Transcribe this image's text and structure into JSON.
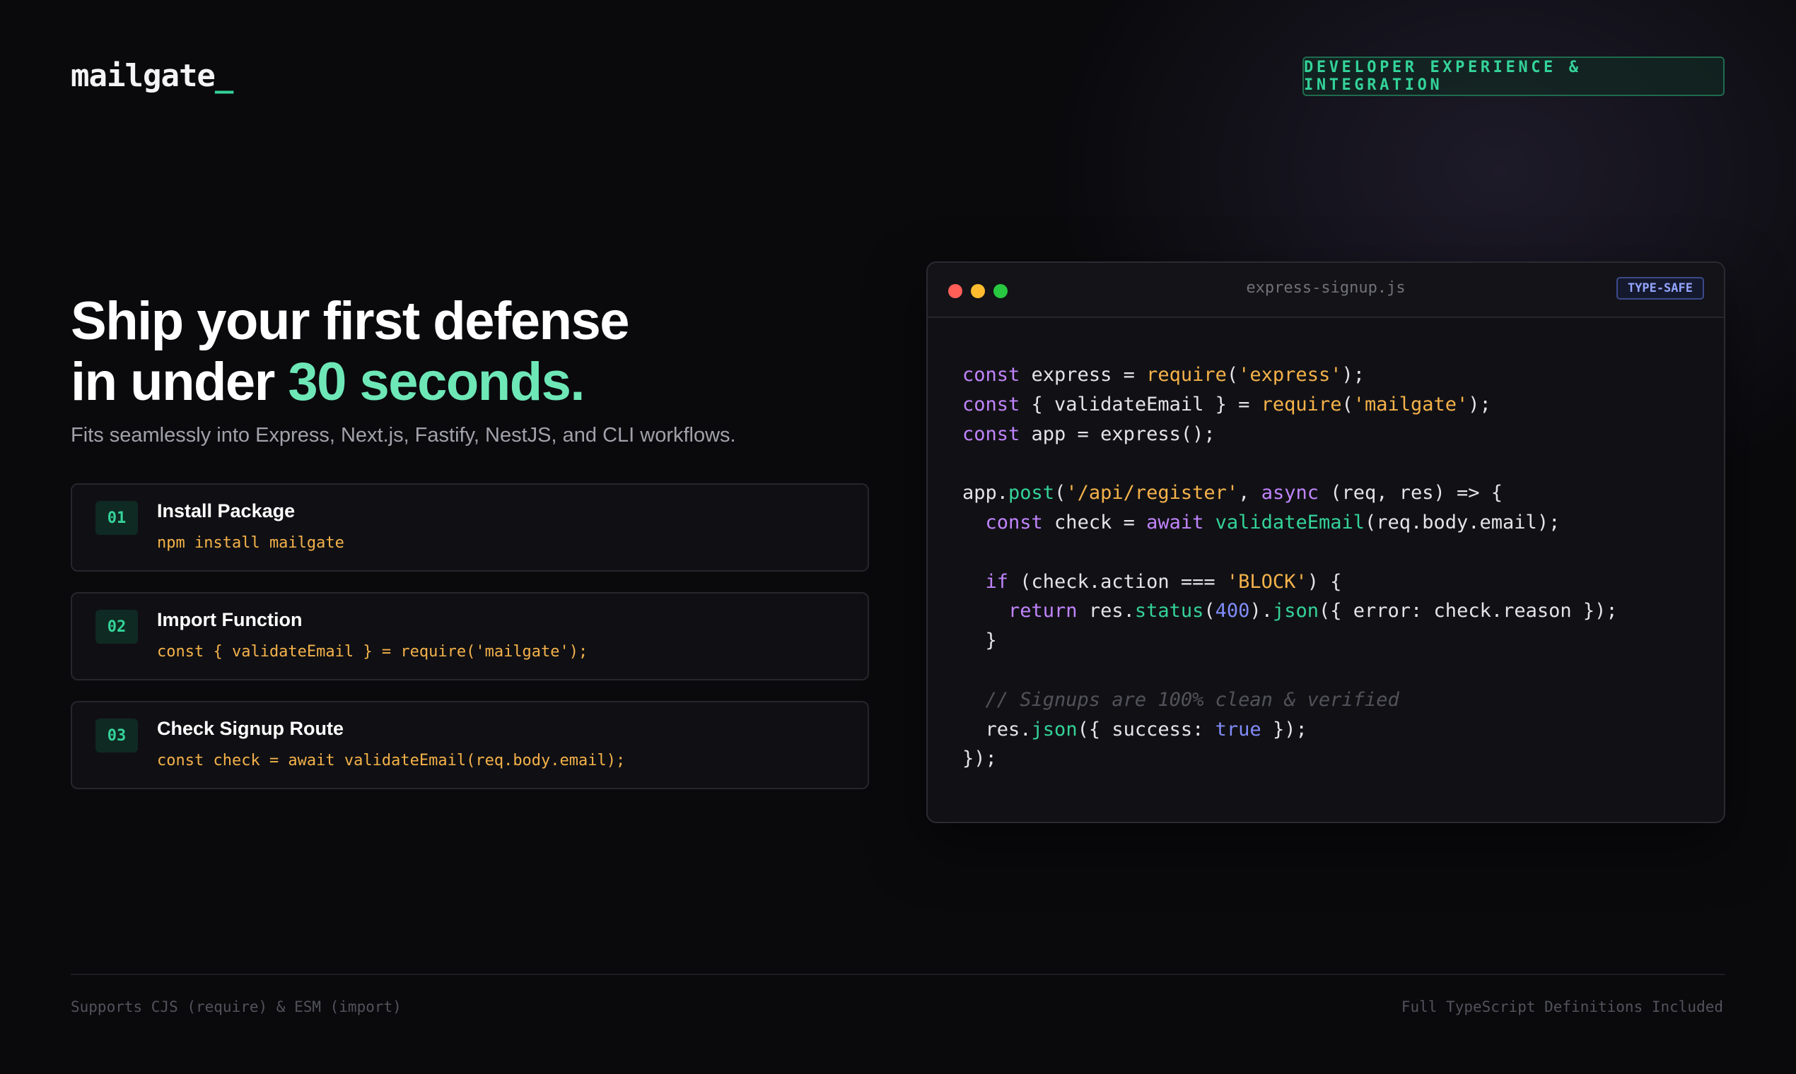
{
  "brand": {
    "name": "mailgate",
    "cursor": "_"
  },
  "section_badge": "DEVELOPER EXPERIENCE & INTEGRATION",
  "hero": {
    "line1": "Ship your first defense",
    "line2_prefix": "in under ",
    "line2_accent": "30 seconds.",
    "subtitle": "Fits seamlessly into Express, Next.js, Fastify, NestJS, and CLI workflows."
  },
  "steps": [
    {
      "number": "01",
      "title": "Install Package",
      "code": "npm install mailgate"
    },
    {
      "number": "02",
      "title": "Import Function",
      "code": "const { validateEmail } = require('mailgate');"
    },
    {
      "number": "03",
      "title": "Check Signup Route",
      "code": "const check = await validateEmail(req.body.email);"
    }
  ],
  "editor": {
    "filename": "express-signup.js",
    "badge": "TYPE-SAFE",
    "code_lines": [
      "const express = require('express');",
      "const { validateEmail } = require('mailgate');",
      "const app = express();",
      "",
      "app.post('/api/register', async (req, res) => {",
      "  const check = await validateEmail(req.body.email);",
      "",
      "  if (check.action === 'BLOCK') {",
      "    return res.status(400).json({ error: check.reason });",
      "  }",
      "",
      "  // Signups are 100% clean & verified",
      "  res.json({ success: true });",
      "});"
    ]
  },
  "footer": {
    "left": "Supports CJS (require) & ESM (import)",
    "right": "Full TypeScript Definitions Included"
  },
  "colors": {
    "background": "#0a0a0d",
    "accent_green": "#34d399",
    "accent_light_green": "#6ee7b7",
    "code_string": "#f5b24a",
    "code_keyword": "#c084fc",
    "code_number": "#818cf8"
  }
}
